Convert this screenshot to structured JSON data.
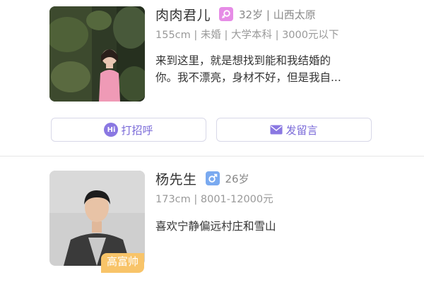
{
  "profiles": [
    {
      "name": "肉肉君儿",
      "gender_icon": "female-icon",
      "meta": "32岁 | 山西太原",
      "info": "155cm | 未婚 | 大学本科 | 3000元以下",
      "bio_line1": "来到这里，就是想找到能和我结婚的",
      "bio_line2": "你。我不漂亮，身材不好，但是我自...",
      "actions": {
        "greet": "打招呼",
        "message": "发留言"
      }
    },
    {
      "name": "杨先生",
      "gender_icon": "male-icon",
      "meta": "26岁",
      "info": "173cm | 8001-12000元",
      "bio_line1": "喜欢宁静偏远村庄和雪山",
      "badge": "高富帅"
    }
  ],
  "colors": {
    "accent": "#7a6ad8",
    "female": "#e68ce6",
    "male": "#7aaaf0",
    "badge": "#f8c469"
  }
}
